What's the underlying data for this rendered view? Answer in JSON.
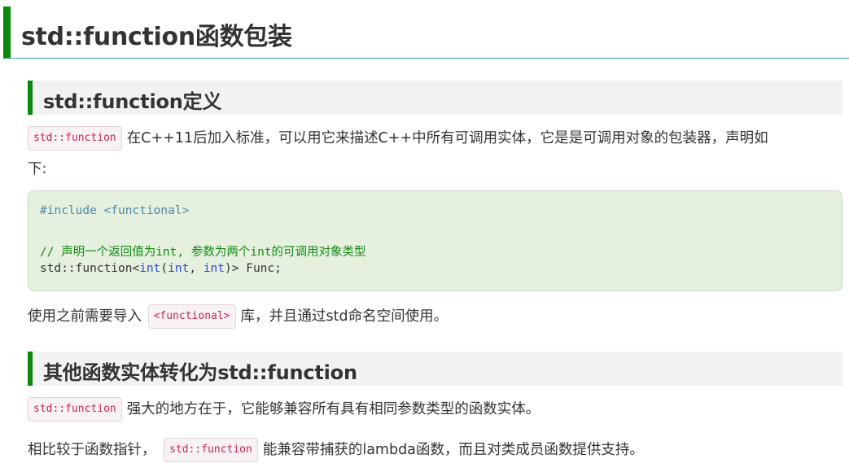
{
  "title": "std::function函数包装",
  "section1": {
    "heading": "std::function定义",
    "intro_code": "std::function",
    "intro_text_1": "在C++11后加入标准，可以用它来描述C++中所有可调用实体，它是是可调用对象的包装器，声明如",
    "intro_text_2": "下:",
    "code": {
      "include": "#include <functional>",
      "comment": "// 声明一个返回值为int, 参数为两个int的可调用对象类型",
      "decl_prefix": "std::function<",
      "kw1": "int",
      "paren_open": "(",
      "kw2": "int",
      "comma": ", ",
      "kw3": "int",
      "decl_suffix": ")> Func;"
    },
    "after_text_1": "使用之前需要导入",
    "after_code": "<functional>",
    "after_text_2": "库，并且通过std命名空间使用。"
  },
  "section2": {
    "heading": "其他函数实体转化为std::function",
    "p1_code": "std::function",
    "p1_text": "强大的地方在于，它能够兼容所有具有相同参数类型的函数实体。",
    "p2_text_1": "相比较于函数指针，",
    "p2_code": "std::function",
    "p2_text_2": "能兼容带捕获的lambda函数，而且对类成员函数提供支持。"
  },
  "colors": {
    "accent_green": "#0a8a0a",
    "rule_blue": "#3f9bb3",
    "inline_code": "#c7254e",
    "code_bg": "#e5f0df"
  }
}
